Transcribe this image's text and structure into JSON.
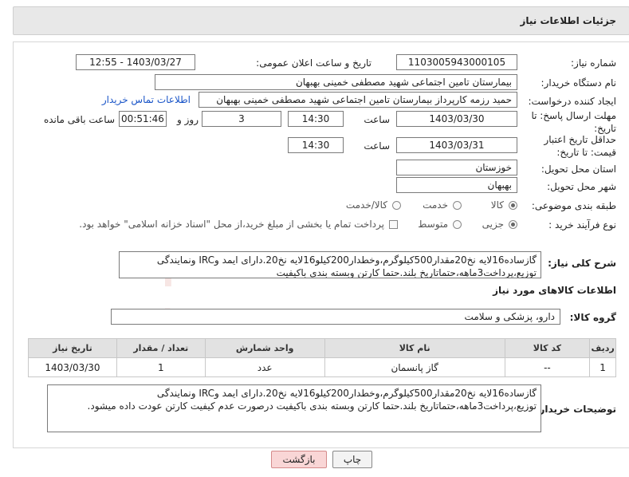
{
  "header": {
    "title": "جزئیات اطلاعات نیاز"
  },
  "form": {
    "need_number_label": "شماره نیاز:",
    "need_number": "1103005943000105",
    "announce_label": "تاریخ و ساعت اعلان عمومی:",
    "announce_value": "1403/03/27 - 12:55",
    "buyer_org_label": "نام دستگاه خریدار:",
    "buyer_org": "بیمارستان تامین اجتماعی شهید مصطفی خمینی بهبهان",
    "requester_label": "ایجاد کننده درخواست:",
    "requester": "حمید رزمه کارپرداز بیمارستان تامین اجتماعی شهید مصطفی خمینی بهبهان",
    "contact_link": "اطلاعات تماس خریدار",
    "deadline_label": "مهلت ارسال پاسخ: تا تاریخ:",
    "deadline_date": "1403/03/30",
    "time_label": "ساعت",
    "deadline_time": "14:30",
    "days_value": "3",
    "days_label": "روز و",
    "remaining_time": "00:51:46",
    "remaining_label": "ساعت باقی مانده",
    "validity_label": "حداقل تاریخ اعتبار قیمت: تا تاریخ:",
    "validity_date": "1403/03/31",
    "validity_time": "14:30",
    "province_label": "استان محل تحویل:",
    "province": "خوزستان",
    "city_label": "شهر محل تحویل:",
    "city": "بهبهان",
    "category_label": "طبقه بندی موضوعی:",
    "category_options": [
      "کالا",
      "خدمت",
      "کالا/خدمت"
    ],
    "process_label": "نوع فرآیند خرید :",
    "process_options": [
      "جزیی",
      "متوسط"
    ],
    "payment_note": "پرداخت تمام یا بخشی از مبلغ خرید،از محل \"اسناد خزانه اسلامی\" خواهد بود.",
    "summary_label": "شرح کلی نیاز:",
    "summary_text": "گازساده16لایه نخ20مقدار500کیلوگرم،وخطدار200کیلو16لایه نخ20.دارای ایمد وIRC ونمایندگی توزیع،پرداخت3ماهه،حتماتاریخ بلند.حتما کارتن وبسته بندی باکیفیت"
  },
  "goods": {
    "section_title": "اطلاعات کالاهای مورد نیاز",
    "group_label": "گروه کالا:",
    "group_value": "دارو، پزشکی و سلامت",
    "columns": [
      "ردیف",
      "کد کالا",
      "نام کالا",
      "واحد شمارش",
      "تعداد / مقدار",
      "تاریخ نیاز"
    ],
    "rows": [
      {
        "index": "1",
        "code": "--",
        "name": "گاز پانسمان",
        "unit": "عدد",
        "qty": "1",
        "date": "1403/03/30"
      }
    ]
  },
  "buyer_notes": {
    "label": "توضیحات خریدار:",
    "text": "گازساده16لایه نخ20مقدار500کیلوگرم،وخطدار200کیلو16لایه نخ20.دارای ایمد وIRC ونمایندگی توزیع،پرداخت3ماهه،حتماتاریخ بلند.حتما کارتن وبسته بندی باکیفیت درصورت عدم کیفیت کارتن عودت داده میشود."
  },
  "buttons": {
    "print": "چاپ",
    "back": "بازگشت"
  },
  "colors": {
    "back_button_bg": "#f9d6d6",
    "back_button_border": "#d48a8a",
    "link": "#1a55c8"
  }
}
